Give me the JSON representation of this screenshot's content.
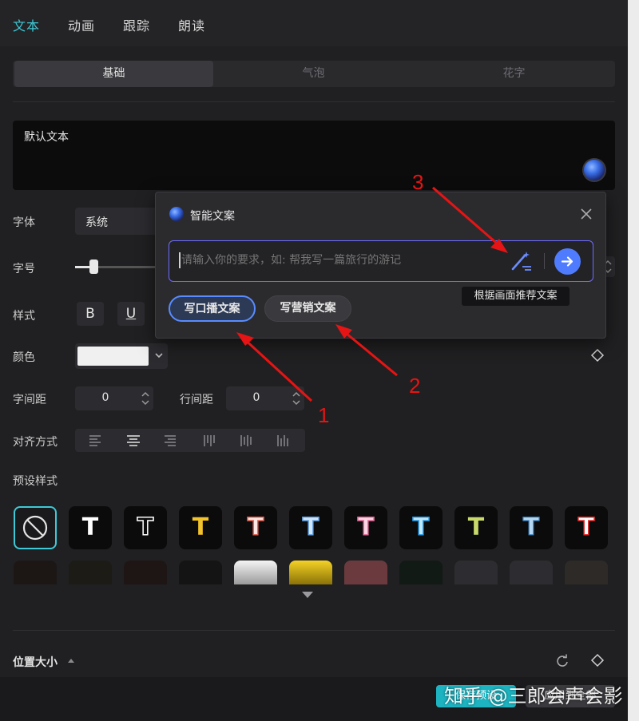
{
  "tabs": [
    {
      "label": "文本"
    },
    {
      "label": "动画"
    },
    {
      "label": "跟踪"
    },
    {
      "label": "朗读"
    }
  ],
  "subtabs": [
    {
      "label": "基础"
    },
    {
      "label": "气泡"
    },
    {
      "label": "花字"
    }
  ],
  "text_box": {
    "value": "默认文本"
  },
  "font": {
    "label": "字体",
    "value": "系统"
  },
  "font_size": {
    "label": "字号"
  },
  "style": {
    "label": "样式",
    "bold": "B",
    "underline": "U"
  },
  "color": {
    "label": "颜色",
    "swatch": "#f0f0f0"
  },
  "spacing": {
    "label": "字间距",
    "value": "0"
  },
  "line_spacing": {
    "label": "行间距",
    "value": "0"
  },
  "align": {
    "label": "对齐方式"
  },
  "presets": {
    "label": "预设样式"
  },
  "position": {
    "label": "位置大小"
  },
  "ai_popup": {
    "title": "智能文案",
    "placeholder": "请输入你的要求，如: 帮我写一篇旅行的游记",
    "chip1": "写口播文案",
    "chip2": "写营销文案",
    "tooltip": "根据画面推荐文案"
  },
  "annotations": {
    "n1": "1",
    "n2": "2",
    "n3": "3"
  },
  "footer": {
    "left": "保存预设",
    "right": "应用到全部"
  },
  "watermark": "知乎 @三郎会声会影",
  "colors": {
    "accent": "#3fc9d6",
    "annotation": "#e61414",
    "input_border": "#6e6cff"
  }
}
